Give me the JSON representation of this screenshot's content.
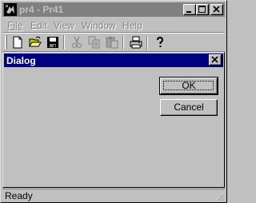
{
  "window": {
    "title": "pr4 - Pr41"
  },
  "title_buttons": [
    "minimize-icon",
    "maximize-icon",
    "close-icon"
  ],
  "menu": [
    {
      "label": "File"
    },
    {
      "label": "Edit"
    },
    {
      "label": "View"
    },
    {
      "label": "Window"
    },
    {
      "label": "Help"
    }
  ],
  "toolbar": [
    "new-icon",
    "open-icon",
    "save-icon",
    "cut-icon",
    "copy-icon",
    "paste-icon",
    "print-icon",
    "help-icon"
  ],
  "dialog": {
    "title": "Dialog",
    "ok_label": "OK",
    "cancel_label": "Cancel"
  },
  "status": {
    "text": "Ready"
  },
  "colors": {
    "face": "#c0c0c0",
    "dialog_title_active": "#000080",
    "main_title_inactive": "#808080"
  }
}
